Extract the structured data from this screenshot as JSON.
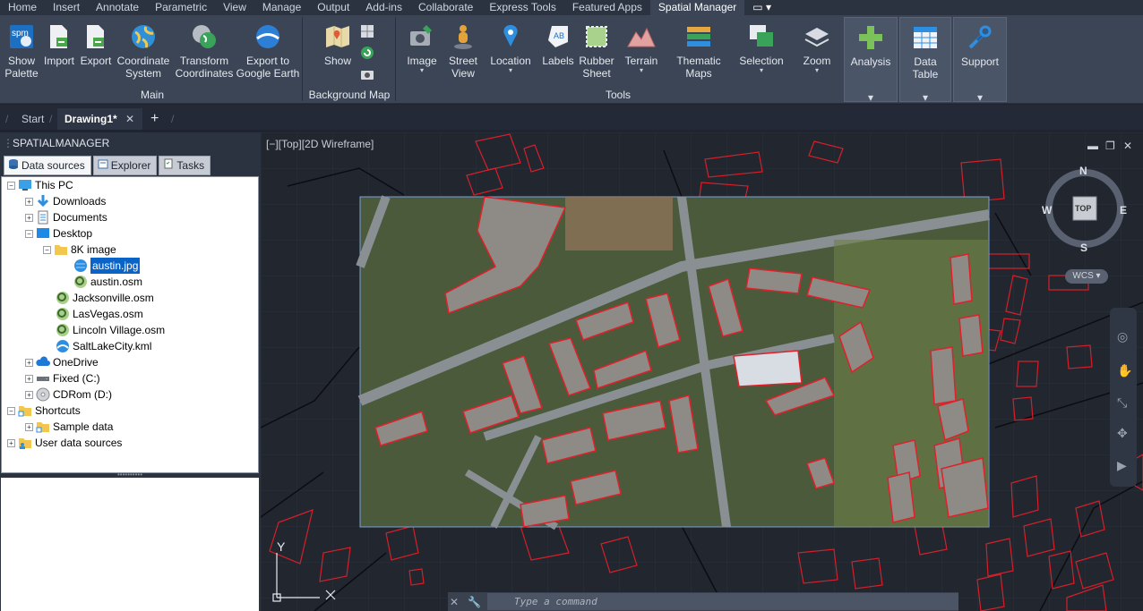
{
  "menu": [
    "Home",
    "Insert",
    "Annotate",
    "Parametric",
    "View",
    "Manage",
    "Output",
    "Add-ins",
    "Collaborate",
    "Express Tools",
    "Featured Apps",
    "Spatial Manager"
  ],
  "menu_active": "Spatial Manager",
  "ribbon": {
    "main": {
      "label": "Main",
      "show_palette": "Show\nPalette",
      "import": "Import",
      "export": "Export",
      "coord_system": "Coordinate\nSystem",
      "transform": "Transform\nCoordinates",
      "google_earth": "Export to\nGoogle Earth"
    },
    "bgmap": {
      "label": "Background Map",
      "show": "Show"
    },
    "tools": {
      "label": "Tools",
      "image": "Image",
      "street_view": "Street\nView",
      "location": "Location",
      "labels": "Labels",
      "rubber_sheet": "Rubber\nSheet",
      "terrain": "Terrain",
      "thematic_maps": "Thematic\nMaps",
      "selection": "Selection",
      "zoom": "Zoom"
    },
    "analysis": "Analysis",
    "data_table": "Data Table",
    "support": "Support"
  },
  "file_tabs": {
    "start": "Start",
    "drawing": "Drawing1*",
    "close": "✕",
    "add": "+"
  },
  "panel": {
    "title": "SPATIALMANAGER",
    "tabs": [
      "Data sources",
      "Explorer",
      "Tasks"
    ],
    "tree": [
      {
        "label": "This PC"
      },
      {
        "label": "Downloads"
      },
      {
        "label": "Documents"
      },
      {
        "label": "Desktop"
      },
      {
        "label": "8K image"
      },
      {
        "label": "austin.jpg"
      },
      {
        "label": "austin.osm"
      },
      {
        "label": "Jacksonville.osm"
      },
      {
        "label": "LasVegas.osm"
      },
      {
        "label": "Lincoln Village.osm"
      },
      {
        "label": "SaltLakeCity.kml"
      },
      {
        "label": "OneDrive"
      },
      {
        "label": "Fixed (C:)"
      },
      {
        "label": "CDRom (D:)"
      },
      {
        "label": "Shortcuts"
      },
      {
        "label": "Sample data"
      },
      {
        "label": "User data sources"
      }
    ]
  },
  "viewport": {
    "label": "[−][Top][2D Wireframe]",
    "compass": {
      "n": "N",
      "s": "S",
      "e": "E",
      "w": "W",
      "top": "TOP",
      "wcs": "WCS"
    },
    "ucs_y": "Y",
    "command_placeholder": "Type a command"
  }
}
